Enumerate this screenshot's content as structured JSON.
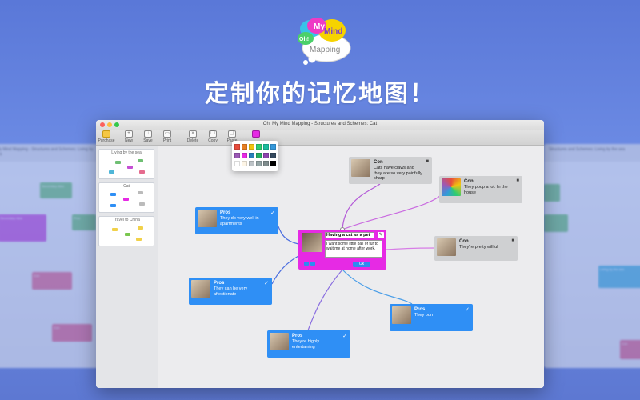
{
  "app": {
    "logo_words": [
      "My",
      "Oh!",
      "Mind",
      "Mapping"
    ],
    "headline": "定制你的记忆地图！",
    "window_title": "Oh! My Mind Mapping - Structures and Schemes: Cat",
    "bg_left_title": "Oh! My Mind Mapping - Structures and Schemes: Living by the sea",
    "bg_right_title": "Structures and Schemes: Living by the sea"
  },
  "toolbar": {
    "purchase": "Purchase",
    "new": "New",
    "save": "Save",
    "print": "Print",
    "delete": "Delete",
    "copy": "Copy",
    "paste": "Paste"
  },
  "sidebar": {
    "maps": [
      {
        "label": "Living by the sea"
      },
      {
        "label": "Cat"
      },
      {
        "label": "Travel to China"
      }
    ]
  },
  "palette": {
    "colors": [
      "#e74c3c",
      "#e67e22",
      "#f1c40f",
      "#2ecc71",
      "#1abc9c",
      "#3498db",
      "#9b59b6",
      "#e62ae4",
      "#2980b9",
      "#27ae60",
      "#8e44ad",
      "#34495e",
      "#ffffff",
      "#fdf5e6",
      "#bdc3c7",
      "#95a5a6",
      "#7f8c8d",
      "#000000"
    ]
  },
  "nodes": {
    "center": {
      "title": "Having a cat as a pet",
      "body": "I want some little ball of fur to wait me at home after work.",
      "ok": "Ok"
    },
    "pros1": {
      "head": "Pros",
      "text": "They do very well in apartments"
    },
    "pros2": {
      "head": "Pros",
      "text": "They can be very affectionate"
    },
    "pros3": {
      "head": "Pros",
      "text": "They're highly entertaining"
    },
    "pros4": {
      "head": "Pros",
      "text": "They purr"
    },
    "con1": {
      "head": "Con",
      "text": "Cats have claws and they are so very painfully sharp"
    },
    "con2": {
      "head": "Con",
      "text": "They poop a lot. In the house"
    },
    "con3": {
      "head": "Con",
      "text": "They're pretty willful"
    }
  },
  "bg_nodes": {
    "secondary1": {
      "head": "Secondary idea",
      "text": "Explanation of idea"
    },
    "secondary2": {
      "head": "Secondary idea",
      "text": "Explanation of idea"
    },
    "pros": {
      "head": "Pros"
    },
    "con": {
      "head": "Con",
      "text": "Living on the coast..."
    },
    "con2": {
      "head": "Con"
    },
    "right_center": {
      "text": "Living by the sea"
    },
    "right_con": {
      "head": "Con"
    }
  }
}
